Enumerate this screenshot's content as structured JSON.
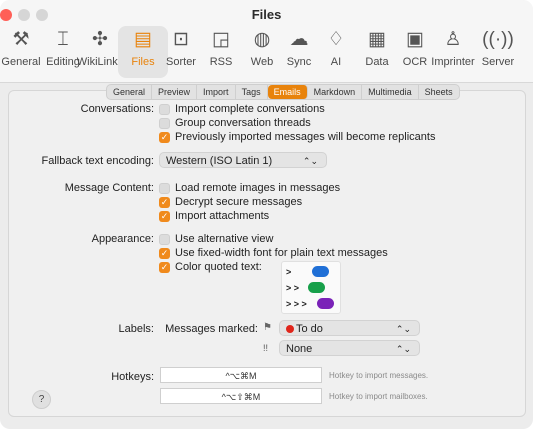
{
  "window": {
    "title": "Files",
    "close_color": "#ff5f57"
  },
  "toolbar": {
    "items": [
      {
        "label": "General",
        "icon": "wrench-screwdriver-icon",
        "glyph": "⚒"
      },
      {
        "label": "Editing",
        "icon": "text-cursor-icon",
        "glyph": "⌶"
      },
      {
        "label": "WikiLinks",
        "icon": "puzzle-icon",
        "glyph": "✣"
      },
      {
        "label": "Files",
        "icon": "files-icon",
        "glyph": "▤"
      },
      {
        "label": "Sorter",
        "icon": "tray-icon",
        "glyph": "⊡"
      },
      {
        "label": "RSS",
        "icon": "rss-icon",
        "glyph": "◲"
      },
      {
        "label": "Web",
        "icon": "globe-icon",
        "glyph": "◍"
      },
      {
        "label": "Sync",
        "icon": "cloud-icon",
        "glyph": "☁"
      },
      {
        "label": "AI",
        "icon": "lightbulb-icon",
        "glyph": "♢"
      },
      {
        "label": "Data",
        "icon": "table-icon",
        "glyph": "▦"
      },
      {
        "label": "OCR",
        "icon": "text-scan-icon",
        "glyph": "▣"
      },
      {
        "label": "Imprinter",
        "icon": "stamp-icon",
        "glyph": "♙"
      },
      {
        "label": "Server",
        "icon": "broadcast-icon",
        "glyph": "((·))"
      }
    ],
    "active": "Files"
  },
  "tabs": [
    "General",
    "Preview",
    "Import",
    "Tags",
    "Emails",
    "Markdown",
    "Multimedia",
    "Sheets"
  ],
  "active_tab": "Emails",
  "conversations": {
    "label": "Conversations:",
    "options": [
      {
        "text": "Import complete conversations",
        "checked": false
      },
      {
        "text": "Group conversation threads",
        "checked": false
      },
      {
        "text": "Previously imported messages will become replicants",
        "checked": true
      }
    ]
  },
  "encoding": {
    "label": "Fallback text encoding:",
    "value": "Western (ISO Latin 1)"
  },
  "message_content": {
    "label": "Message Content:",
    "options": [
      {
        "text": "Load remote images in messages",
        "checked": false
      },
      {
        "text": "Decrypt secure messages",
        "checked": true
      },
      {
        "text": "Import attachments",
        "checked": true
      }
    ]
  },
  "appearance": {
    "label": "Appearance:",
    "options": [
      {
        "text": "Use alternative view",
        "checked": false
      },
      {
        "text": "Use fixed-width font for plain text messages",
        "checked": true
      },
      {
        "text": "Color quoted text:",
        "checked": true
      }
    ],
    "quotes": [
      {
        "marker": ">",
        "color": "#1f6fd6"
      },
      {
        "marker": "> >",
        "color": "#17a04a"
      },
      {
        "marker": "> > >",
        "color": "#7a22b8"
      }
    ]
  },
  "labels": {
    "label": "Labels:",
    "marked_label": "Messages marked:",
    "flag_icon": "flag-icon",
    "marked_value": "To do",
    "marked_color": "#e0251b",
    "priority_marker": "!!",
    "priority_value": "None"
  },
  "hotkeys": {
    "label": "Hotkeys:",
    "messages_value": "^⌥⌘M",
    "messages_hint": "Hotkey to import messages.",
    "mailboxes_value": "^⌥⇧⌘M",
    "mailboxes_hint": "Hotkey to import mailboxes."
  },
  "help": "?"
}
